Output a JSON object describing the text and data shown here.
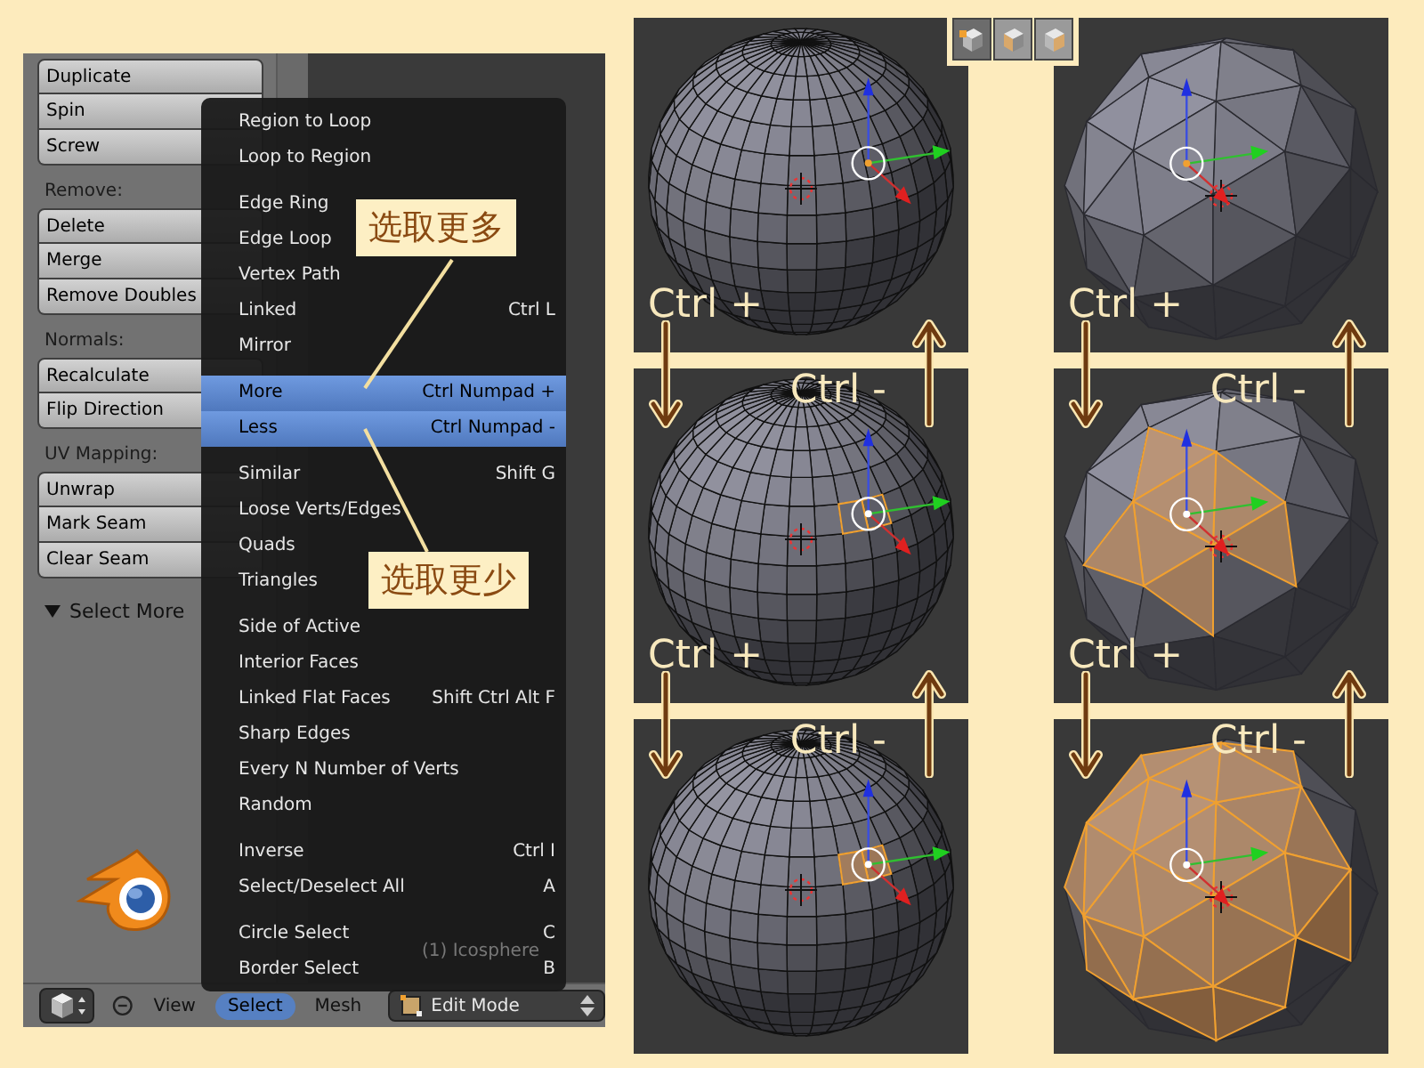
{
  "tool_shelf": {
    "items": [
      {
        "kind": "button",
        "label": "Duplicate"
      },
      {
        "kind": "button",
        "label": "Spin"
      },
      {
        "kind": "button",
        "label": "Screw"
      },
      {
        "kind": "heading",
        "label": "Remove:"
      },
      {
        "kind": "button",
        "label": "Delete"
      },
      {
        "kind": "button",
        "label": "Merge"
      },
      {
        "kind": "button",
        "label": "Remove Doubles"
      },
      {
        "kind": "heading",
        "label": "Normals:"
      },
      {
        "kind": "button",
        "label": "Recalculate"
      },
      {
        "kind": "button",
        "label": "Flip Direction"
      },
      {
        "kind": "heading",
        "label": "UV Mapping:"
      },
      {
        "kind": "button",
        "label": "Unwrap"
      },
      {
        "kind": "button",
        "label": "Mark Seam"
      },
      {
        "kind": "button",
        "label": "Clear Seam"
      }
    ],
    "panel_header": {
      "label": "Select More",
      "expanded": true
    }
  },
  "menu": {
    "groups": [
      [
        {
          "label": "Region to Loop",
          "selected": false
        },
        {
          "label": "Loop to Region",
          "selected": false
        }
      ],
      [
        {
          "label": "Edge Ring",
          "selected": false
        },
        {
          "label": "Edge Loop",
          "selected": false
        },
        {
          "label": "Vertex Path",
          "selected": false
        },
        {
          "label": "Linked",
          "shortcut": "Ctrl L",
          "selected": false
        },
        {
          "label": "Mirror",
          "selected": false
        }
      ],
      [
        {
          "label": "More",
          "shortcut": "Ctrl Numpad +",
          "selected": true
        },
        {
          "label": "Less",
          "shortcut": "Ctrl Numpad -",
          "selected": true
        }
      ],
      [
        {
          "label": "Similar",
          "shortcut": "Shift G",
          "selected": false
        },
        {
          "label": "Loose Verts/Edges",
          "selected": false
        },
        {
          "label": "Quads",
          "selected": false
        },
        {
          "label": "Triangles",
          "selected": false
        }
      ],
      [
        {
          "label": "Side of Active",
          "selected": false
        },
        {
          "label": "Interior Faces",
          "selected": false
        },
        {
          "label": "Linked Flat Faces",
          "shortcut": "Shift Ctrl Alt F",
          "selected": false
        },
        {
          "label": "Sharp Edges",
          "selected": false
        },
        {
          "label": "Every N Number of Verts",
          "selected": false
        },
        {
          "label": "Random",
          "selected": false
        }
      ],
      [
        {
          "label": "Inverse",
          "shortcut": "Ctrl I",
          "selected": false
        },
        {
          "label": "Select/Deselect All",
          "shortcut": "A",
          "selected": false
        }
      ],
      [
        {
          "label": "Circle Select",
          "shortcut": "C",
          "selected": false
        },
        {
          "label": "Border Select",
          "shortcut": "B",
          "selected": false
        }
      ]
    ]
  },
  "viewport_caption": "(1) Icosphere",
  "callouts": [
    {
      "text": "选取更多"
    },
    {
      "text": "选取更少"
    }
  ],
  "header": {
    "menus": [
      {
        "label": "View",
        "selected": false
      },
      {
        "label": "Select",
        "selected": true
      },
      {
        "label": "Mesh",
        "selected": false
      }
    ],
    "mode": "Edit Mode"
  },
  "select_mode_buttons": [
    {
      "kind": "vertex",
      "selected": true
    },
    {
      "kind": "edge",
      "selected": false
    },
    {
      "kind": "face",
      "selected": false
    }
  ],
  "viewports": [
    {
      "kind": "uv_sphere",
      "selection": {
        "kind": "vertex"
      },
      "bottom_label": "Ctrl +"
    },
    {
      "kind": "icosphere",
      "selection": {
        "kind": "vertex"
      },
      "bottom_label": "Ctrl +"
    },
    {
      "kind": "uv_sphere",
      "selection": {
        "kind": "edges"
      },
      "top_label": "Ctrl -",
      "bottom_label": "Ctrl +"
    },
    {
      "kind": "icosphere",
      "selection": {
        "kind": "region"
      },
      "top_label": "Ctrl -",
      "bottom_label": "Ctrl +"
    },
    {
      "kind": "uv_sphere",
      "selection": {
        "kind": "faces"
      },
      "top_label": "Ctrl -"
    },
    {
      "kind": "icosphere",
      "selection": {
        "kind": "wide"
      },
      "top_label": "Ctrl -"
    }
  ]
}
